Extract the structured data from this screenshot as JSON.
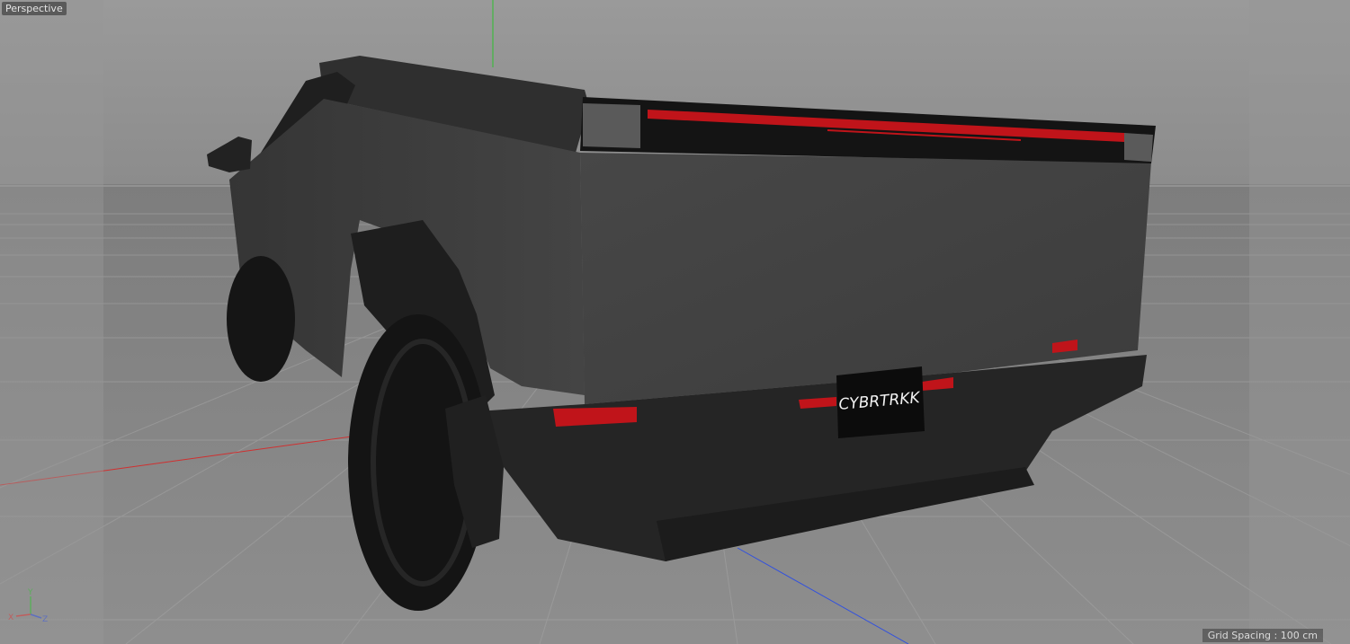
{
  "viewport": {
    "view_name": "Perspective",
    "grid_spacing_label": "Grid Spacing : 100 cm"
  },
  "axis_gizmo": {
    "y_label": "Y",
    "x_label": "X",
    "z_label": "Z"
  },
  "model": {
    "license_plate_text": "CYBRTRKK"
  },
  "colors": {
    "background": "#8f8f8f",
    "truck_body": "#3c3c3c",
    "taillight": "#c0141a",
    "axis_x": "#e03030",
    "axis_y": "#2ec02e",
    "axis_z": "#3050e0"
  }
}
